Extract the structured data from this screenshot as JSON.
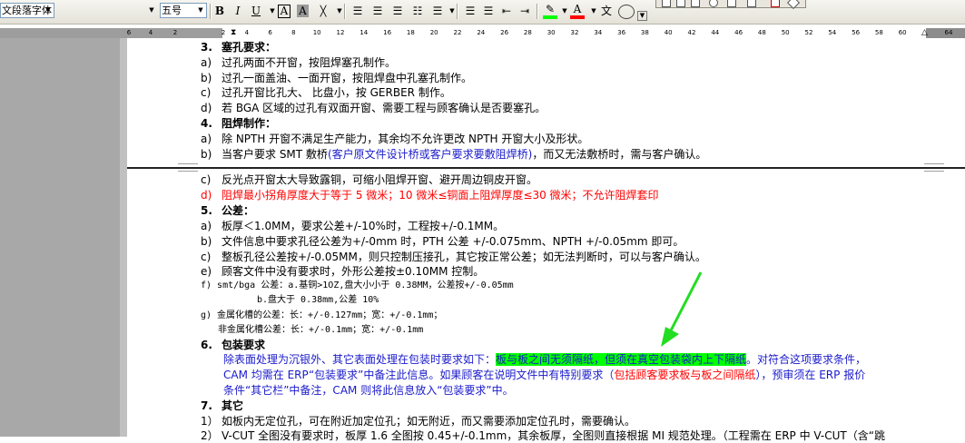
{
  "toolbar": {
    "style_value": "文段落字体",
    "font_size_value": "五号",
    "buttons": {
      "bold": "B",
      "italic": "I",
      "underline": "U",
      "border": "A",
      "shading": "A",
      "scale": "╳"
    },
    "icons": [
      "bold-icon",
      "italic-icon",
      "underline-icon",
      "char-border-icon",
      "char-shading-icon",
      "char-scale-icon",
      "align-left-icon",
      "align-center-icon",
      "align-right-icon",
      "justify-icon",
      "line-spacing-icon",
      "numbering-icon",
      "bullets-icon",
      "decrease-indent-icon",
      "increase-indent-icon",
      "highlight-icon",
      "font-color-icon",
      "phonetic-icon",
      "encircle-icon"
    ],
    "phonetic_label": "文",
    "colors": {
      "highlight": "#00ff00",
      "font_color": "#ff0000"
    }
  },
  "ruler": {
    "numbers_left": [
      "6",
      "4",
      "2"
    ],
    "numbers_right": [
      "2",
      "4",
      "6",
      "8",
      "10",
      "12",
      "14",
      "16",
      "18",
      "20",
      "22",
      "24",
      "26",
      "28",
      "30",
      "32",
      "34",
      "36",
      "38",
      "40",
      "42",
      "44",
      "46",
      "48",
      "50",
      "52",
      "54",
      "56",
      "58",
      "60",
      "64"
    ]
  },
  "document": {
    "top_lines": [
      {
        "label": "3.",
        "text": "塞孔要求：",
        "bold": true
      },
      {
        "label": "a)",
        "text": "过孔两面不开窗，按阻焊塞孔制作。"
      },
      {
        "label": "b)",
        "text": "过孔一面盖油、一面开窗，按阻焊盘中孔塞孔制作。"
      },
      {
        "label": "c)",
        "text": "过孔开窗比孔大、 比盘小，按 GERBER 制作。"
      },
      {
        "label": "d)",
        "text": "若 BGA 区域的过孔有双面开窗、需要工程与顾客确认是否要塞孔。"
      },
      {
        "label": "4.",
        "text": "阻焊制作：",
        "bold": true
      },
      {
        "label": "a)",
        "text": "除 NPTH 开窗不满足生产能力，其余均不允许更改 NPTH 开窗大小及形状。"
      }
    ],
    "line_b2": {
      "label": "b)",
      "part1": "当客户要求 SMT 敷桥",
      "part2": "(客户原文件设计桥或客户要求要敷阻焊桥)",
      "part3": "，而又无法敷桥时，需与客户确认。"
    },
    "bottom_lines": [
      {
        "label": "c)",
        "text": "反光点开窗太大导致露铜，可缩小阻焊开窗、避开周边铜皮开窗。"
      },
      {
        "label": "d)",
        "text": "阻焊最小拐角厚度大于等于 5 微米；10 微米≤铜面上阻焊厚度≤30 微米；不允许阻焊套印",
        "red": true
      },
      {
        "label": "5.",
        "text": "公差：",
        "bold": true
      },
      {
        "label": "a)",
        "text": "板厚＜1.0MM，要求公差+/-10%时，工程按+/-0.1MM。"
      },
      {
        "label": "b)",
        "text": "文件信息中要求孔径公差为+/-0mm 时，PTH 公差 +/-0.075mm、NPTH +/-0.05mm 即可。"
      },
      {
        "label": "c)",
        "text": "整板孔径公差按+/-0.05MM，则只控制压接孔，其它按正常公差；如无法判断时，可以与客户确认。"
      },
      {
        "label": "e)",
        "text": "顾客文件中没有要求时，外形公差按±0.10MM 控制。"
      }
    ],
    "f_line": "f)  smt/bga 公差：a.基铜>1OZ,盘大小小于 0.38MM，公差按+/-0.05mm",
    "f_line2": "b.盘大于 0.38mm,公差 10%",
    "g_line": "g) 金属化槽的公差：长：+/-0.127mm；宽：+/-0.1mm；",
    "g_line2": "非金属化槽公差：长：+/-0.1mm；宽：+/-0.1mm",
    "section6": {
      "label": "6.",
      "title": "包装要求"
    },
    "pack_line1": {
      "part1": "除表面处理为沉银外、其它表面处理在包装时要求如下：",
      "highlight": "板与板之间无须隔纸，但须在真空包装袋内上下隔纸",
      "part2": "。对符合这项要求条件，"
    },
    "pack_line2": {
      "part1": "CAM 均需在 ERP“包装要求”中备注此信息。如果顾客在说明文件中有特别要求（",
      "red": "包括顾客要求板与板之间隔纸",
      "part2": "），预审须在 ERP 报价"
    },
    "pack_line3": "条件“其它栏”中备注，CAM 则将此信息放入“包装要求”中。",
    "section7": {
      "label": "7.",
      "title": "其它"
    },
    "other_line1": {
      "label": "1）",
      "text": "如板内无定位孔，可在附近加定位孔；如无附近，而又需要添加定位孔时，需要确认。"
    },
    "other_line2": {
      "label": "2）",
      "text": "V-CUT 全图没有要求时，板厚 1.6 全图按 0.45+/-0.1mm，其余板厚，全图则直接根据 MI 规范处理。（工程需在 ERP 中 V-CUT（含“跳"
    }
  },
  "colors": {
    "arrow": "#22dd22",
    "highlight": "#00ff00",
    "red_text": "#ff0000",
    "blue_text": "#1a1acc"
  }
}
